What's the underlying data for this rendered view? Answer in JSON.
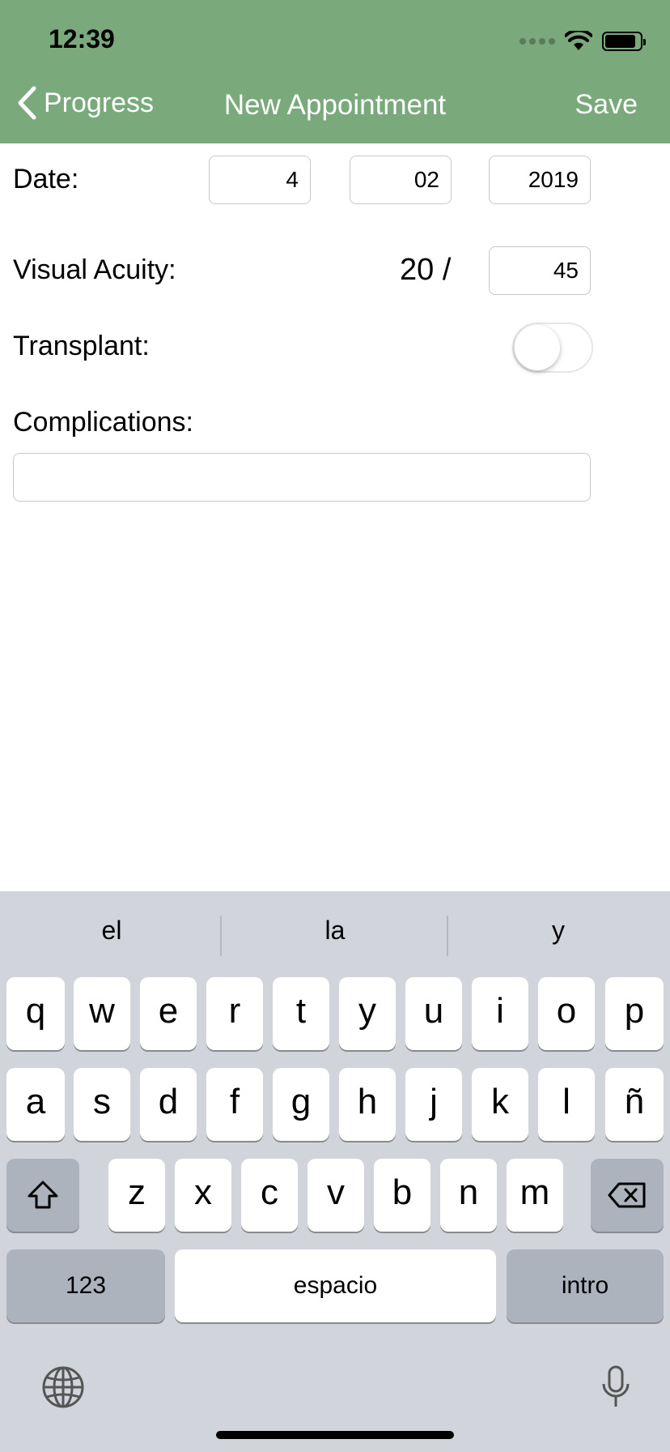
{
  "status": {
    "time": "12:39"
  },
  "nav": {
    "back_label": "Progress",
    "title": "New Appointment",
    "save_label": "Save"
  },
  "form": {
    "date_label": "Date:",
    "date_day": "4",
    "date_month": "02",
    "date_year": "2019",
    "acuity_label": "Visual Acuity:",
    "acuity_prefix": "20 /",
    "acuity_value": "45",
    "transplant_label": "Transplant:",
    "transplant_on": false,
    "complications_label": "Complications:",
    "complications_value": ""
  },
  "keyboard": {
    "suggestions": [
      "el",
      "la",
      "y"
    ],
    "row1": [
      "q",
      "w",
      "e",
      "r",
      "t",
      "y",
      "u",
      "i",
      "o",
      "p"
    ],
    "row2": [
      "a",
      "s",
      "d",
      "f",
      "g",
      "h",
      "j",
      "k",
      "l",
      "ñ"
    ],
    "row3": [
      "z",
      "x",
      "c",
      "v",
      "b",
      "n",
      "m"
    ],
    "numbers_label": "123",
    "space_label": "espacio",
    "return_label": "intro"
  },
  "colors": {
    "header": "#7aa97b",
    "keyboard_bg": "#d1d4da",
    "key_dark": "#adb3bd"
  }
}
